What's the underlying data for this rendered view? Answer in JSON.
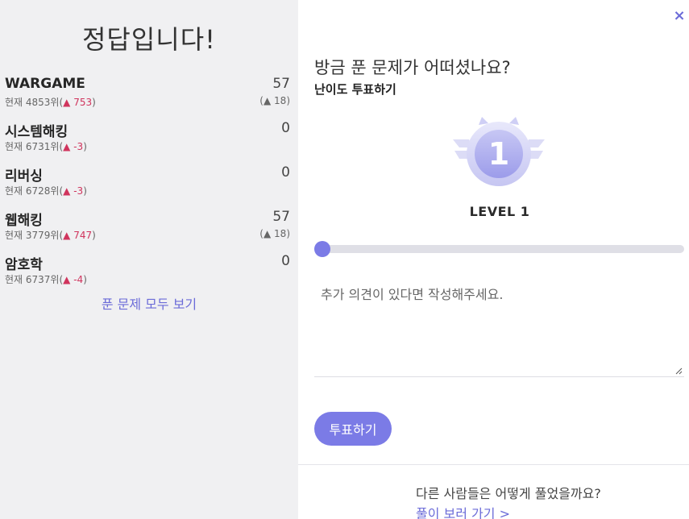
{
  "result": {
    "title": "정답입니다!"
  },
  "categories": [
    {
      "name": "WARGAME",
      "score": "57",
      "rank_prefix": "현재 4853위(",
      "rank_delta": "753",
      "rank_suffix": ")",
      "score_delta_prefix": "(",
      "score_delta": "18",
      "score_delta_suffix": ")"
    },
    {
      "name": "시스템해킹",
      "score": "0",
      "rank_prefix": "현재 6731위(",
      "rank_delta": "-3",
      "rank_suffix": ")"
    },
    {
      "name": "리버싱",
      "score": "0",
      "rank_prefix": "현재 6728위(",
      "rank_delta": "-3",
      "rank_suffix": ")"
    },
    {
      "name": "웹해킹",
      "score": "57",
      "rank_prefix": "현재 3779위(",
      "rank_delta": "747",
      "rank_suffix": ")",
      "score_delta_prefix": "(",
      "score_delta": "18",
      "score_delta_suffix": ")"
    },
    {
      "name": "암호학",
      "score": "0",
      "rank_prefix": "현재 6737위(",
      "rank_delta": "-4",
      "rank_suffix": ")"
    }
  ],
  "view_all_label": "푼 문제 모두 보기",
  "icons": {
    "close": "close-icon",
    "up": "triangle-up-icon",
    "badge": "level-1-badge-icon",
    "grip": "resize-grip-icon"
  },
  "triangle_glyph": "▲",
  "close_glyph": "×",
  "vote": {
    "question": "방금 푼 문제가 어떠셨나요?",
    "subtitle": "난이도 투표하기",
    "badge_number": "1",
    "level_label": "LEVEL 1",
    "slider_value": 1,
    "comment_placeholder": "추가 의견이 있다면 작성해주세요.",
    "submit_label": "투표하기"
  },
  "others": {
    "question": "다른 사람들은 어떻게 풀었을까요?",
    "link_label": "풀이 보러 가기 >"
  },
  "colors": {
    "accent": "#7b7be6",
    "up_red": "#d0345d",
    "left_bg": "#f0f0f2"
  }
}
